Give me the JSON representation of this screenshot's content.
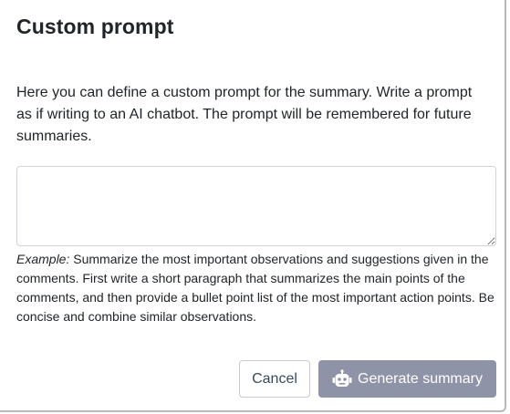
{
  "dialog": {
    "title": "Custom prompt",
    "description": "Here you can define a custom prompt for the summary. Write a prompt as if writing to an AI chatbot. The prompt will be remembered for future summaries.",
    "prompt_value": "",
    "prompt_placeholder": "",
    "example_label": "Example:",
    "example_text": " Summarize the most important observations and suggestions given in the comments. First write a short paragraph that summarizes the main points of the comments, and then provide a bullet point list of the most important action points. Be concise and combine similar observations.",
    "cancel_label": "Cancel",
    "generate_label": "Generate summary",
    "generate_icon": "robot-icon"
  },
  "colors": {
    "generate_button_bg": "#8e93a8",
    "cancel_text": "#3a4a5c",
    "text": "#212529"
  }
}
